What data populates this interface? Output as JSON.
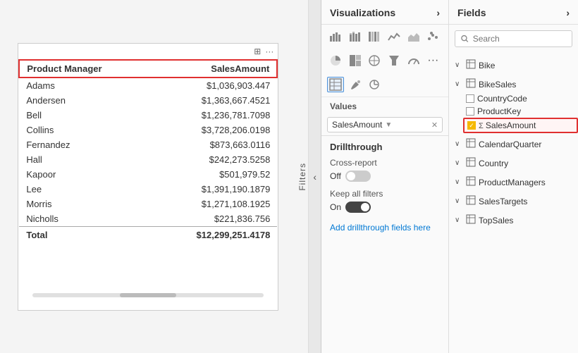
{
  "left_panel": {
    "table": {
      "columns": [
        "Product Manager",
        "SalesAmount"
      ],
      "rows": [
        {
          "manager": "Adams",
          "amount": "$1,036,903.447"
        },
        {
          "manager": "Andersen",
          "amount": "$1,363,667.4521"
        },
        {
          "manager": "Bell",
          "amount": "$1,236,781.7098"
        },
        {
          "manager": "Collins",
          "amount": "$3,728,206.0198"
        },
        {
          "manager": "Fernandez",
          "amount": "$873,663.0116"
        },
        {
          "manager": "Hall",
          "amount": "$242,273.5258"
        },
        {
          "manager": "Kapoor",
          "amount": "$501,979.52"
        },
        {
          "manager": "Lee",
          "amount": "$1,391,190.1879"
        },
        {
          "manager": "Morris",
          "amount": "$1,271,108.1925"
        },
        {
          "manager": "Nicholls",
          "amount": "$221,836.756"
        }
      ],
      "total_label": "Total",
      "total_amount": "$12,299,251.4178"
    }
  },
  "filters_label": "Filters",
  "visualizations": {
    "title": "Visualizations",
    "chevron_left": "‹",
    "chevron_right": "›",
    "values_section": "Values",
    "values_chip": "SalesAmount",
    "drillthrough": {
      "title": "Drillthrough",
      "cross_report_label": "Cross-report",
      "cross_report_value": "Off",
      "keep_filters_label": "Keep all filters",
      "keep_filters_value": "On",
      "add_label": "Add drillthrough fields here"
    }
  },
  "fields": {
    "title": "Fields",
    "chevron_right": "›",
    "search_placeholder": "Search",
    "categories": [
      {
        "name": "Bike",
        "icon": "table",
        "expanded": false,
        "items": []
      },
      {
        "name": "BikeSales",
        "icon": "table",
        "expanded": true,
        "items": [
          {
            "name": "CountryCode",
            "checked": false,
            "is_sigma": false,
            "highlighted": false
          },
          {
            "name": "ProductKey",
            "checked": false,
            "is_sigma": false,
            "highlighted": false
          },
          {
            "name": "SalesAmount",
            "checked": true,
            "is_sigma": true,
            "highlighted": true
          }
        ]
      },
      {
        "name": "CalendarQuarter",
        "icon": "table",
        "expanded": false,
        "items": []
      },
      {
        "name": "Country",
        "icon": "table",
        "expanded": false,
        "items": []
      },
      {
        "name": "ProductManagers",
        "icon": "table",
        "expanded": false,
        "items": []
      },
      {
        "name": "SalesTargets",
        "icon": "table",
        "expanded": false,
        "items": []
      },
      {
        "name": "TopSales",
        "icon": "table",
        "expanded": false,
        "items": []
      }
    ]
  }
}
